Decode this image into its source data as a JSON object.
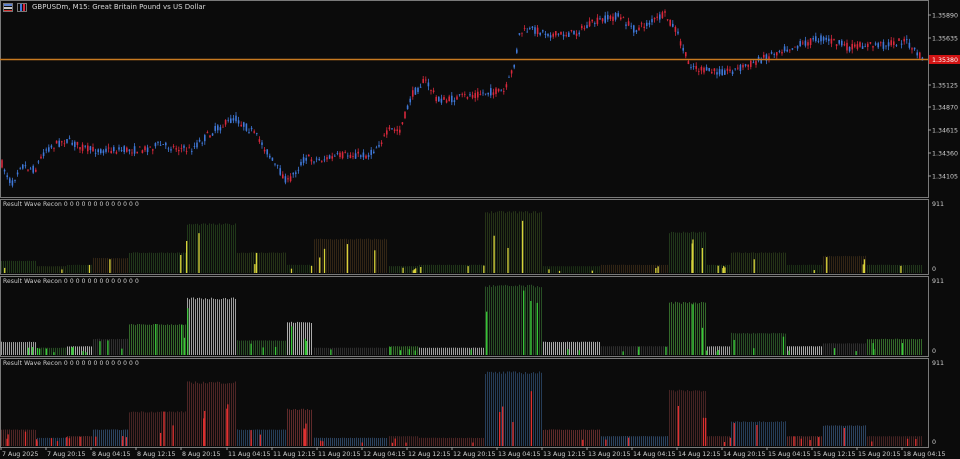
{
  "window": {
    "symbol_title": "GBPUSDm, M15:  Great Britain Pound vs US Dollar"
  },
  "colors": {
    "background": "#0b0b0b",
    "bull_candle": "#3f78d8",
    "bear_candle": "#d8283c",
    "price_line": "#c87a20",
    "price_tag": "#d21414",
    "axis_text": "#cfcfcf",
    "separator": "#8c8c8c"
  },
  "price_axis": {
    "ticks": [
      "1.35890",
      "1.35635",
      "1.35380",
      "1.35125",
      "1.34870",
      "1.34615",
      "1.34360",
      "1.34105"
    ],
    "current_price": "1.35380"
  },
  "time_axis": {
    "labels": [
      "7 Aug 2025",
      "7 Aug 20:15",
      "8 Aug 04:15",
      "8 Aug 12:15",
      "8 Aug 20:15",
      "11 Aug 04:15",
      "11 Aug 12:15",
      "11 Aug 20:15",
      "12 Aug 04:15",
      "12 Aug 12:15",
      "12 Aug 20:15",
      "13 Aug 04:15",
      "13 Aug 12:15",
      "13 Aug 20:15",
      "14 Aug 04:15",
      "14 Aug 12:15",
      "14 Aug 20:15",
      "15 Aug 04:15",
      "15 Aug 12:15",
      "15 Aug 20:15",
      "18 Aug 04:15"
    ]
  },
  "indicator_panels": [
    {
      "title": "Result Wave Recon 0 0 0 0 0 0 0 0 0 0 0 0 0",
      "scale_top": "911",
      "scale_bottom": "0",
      "palette": "yellow-green"
    },
    {
      "title": "Result Wave Recon 0 0 0 0 0 0 0 0 0 0 0 0 0",
      "scale_top": "911",
      "scale_bottom": "0",
      "palette": "green-white"
    },
    {
      "title": "Result Wave Recon 0 0 0 0 0 0 0 0 0 0 0 0 0",
      "scale_top": "911",
      "scale_bottom": "0",
      "palette": "red-blue"
    }
  ]
}
